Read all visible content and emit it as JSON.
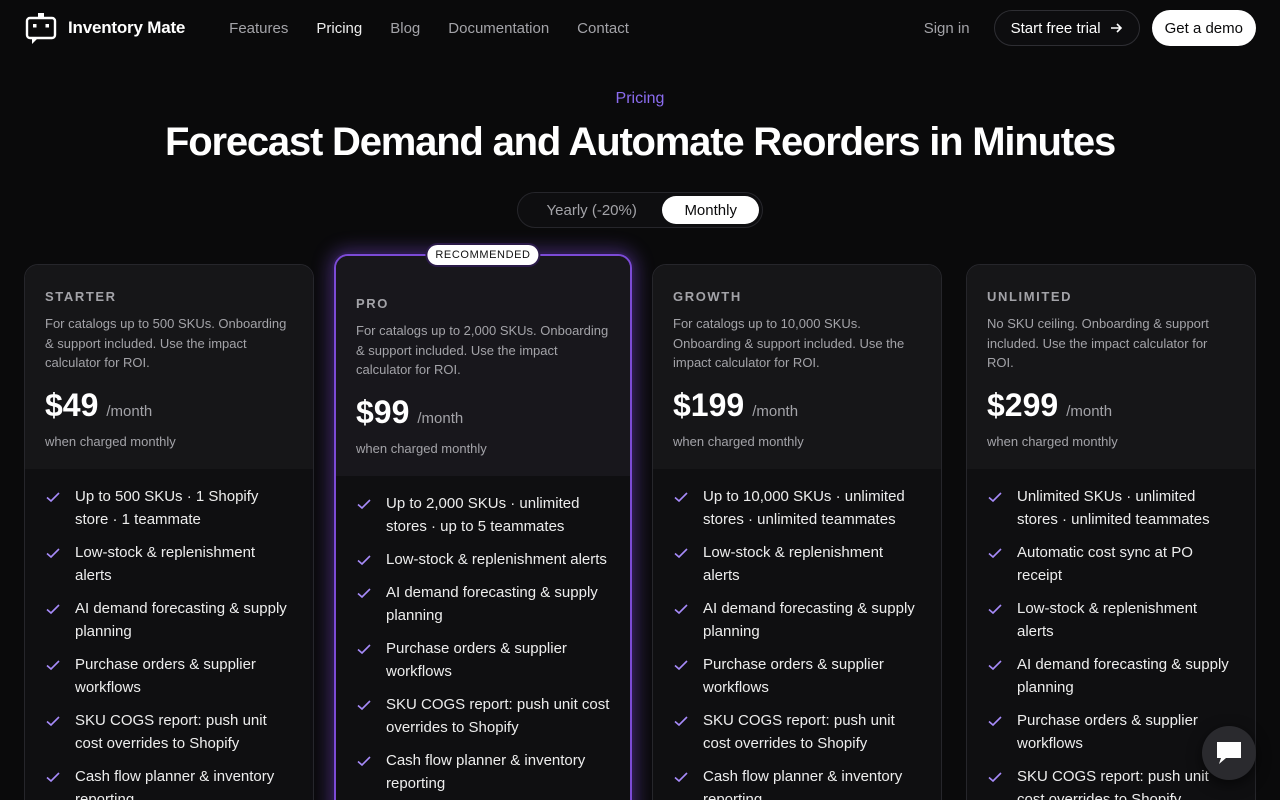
{
  "nav": {
    "brand": "Inventory Mate",
    "links": [
      "Features",
      "Pricing",
      "Blog",
      "Documentation",
      "Contact"
    ],
    "active": "Pricing",
    "signin": "Sign in",
    "trial": "Start free trial",
    "demo": "Get a demo"
  },
  "hero": {
    "eyebrow": "Pricing",
    "title": "Forecast Demand and Automate Reorders in Minutes"
  },
  "billing": {
    "yearly": "Yearly (-20%)",
    "monthly": "Monthly",
    "selected": "Monthly"
  },
  "colors": {
    "accent": "#8b6cf0",
    "featured_border": "#7c4bd6",
    "check": "#a78bfa"
  },
  "plans": [
    {
      "tier": "STARTER",
      "desc": "For catalogs up to 500 SKUs. Onboarding & support included. Use the impact calculator for ROI.",
      "price": "$49",
      "period": "/month",
      "charged": "when charged monthly",
      "features": [
        "Up to 500 SKUs · 1 Shopify store · 1 teammate",
        "Low-stock & replenishment alerts",
        "AI demand forecasting & supply planning",
        "Purchase orders & supplier workflows",
        "SKU COGS report: push unit cost overrides to Shopify",
        "Cash flow planner & inventory reporting"
      ]
    },
    {
      "tier": "PRO",
      "badge": "RECOMMENDED",
      "desc": "For catalogs up to 2,000 SKUs. Onboarding & support included. Use the impact calculator for ROI.",
      "price": "$99",
      "period": "/month",
      "charged": "when charged monthly",
      "features": [
        "Up to 2,000 SKUs · unlimited stores · up to 5 teammates",
        "Low-stock & replenishment alerts",
        "AI demand forecasting & supply planning",
        "Purchase orders & supplier workflows",
        "SKU COGS report: push unit cost overrides to Shopify",
        "Cash flow planner & inventory reporting"
      ]
    },
    {
      "tier": "GROWTH",
      "desc": "For catalogs up to 10,000 SKUs. Onboarding & support included. Use the impact calculator for ROI.",
      "price": "$199",
      "period": "/month",
      "charged": "when charged monthly",
      "features": [
        "Up to 10,000 SKUs · unlimited stores · unlimited teammates",
        "Low-stock & replenishment alerts",
        "AI demand forecasting & supply planning",
        "Purchase orders & supplier workflows",
        "SKU COGS report: push unit cost overrides to Shopify",
        "Cash flow planner & inventory reporting"
      ]
    },
    {
      "tier": "UNLIMITED",
      "desc": "No SKU ceiling. Onboarding & support included. Use the impact calculator for ROI.",
      "price": "$299",
      "period": "/month",
      "charged": "when charged monthly",
      "features": [
        "Unlimited SKUs · unlimited stores · unlimited teammates",
        "Automatic cost sync at PO receipt",
        "Low-stock & replenishment alerts",
        "AI demand forecasting & supply planning",
        "Purchase orders & supplier workflows",
        "SKU COGS report: push unit cost overrides to Shopify"
      ]
    }
  ]
}
